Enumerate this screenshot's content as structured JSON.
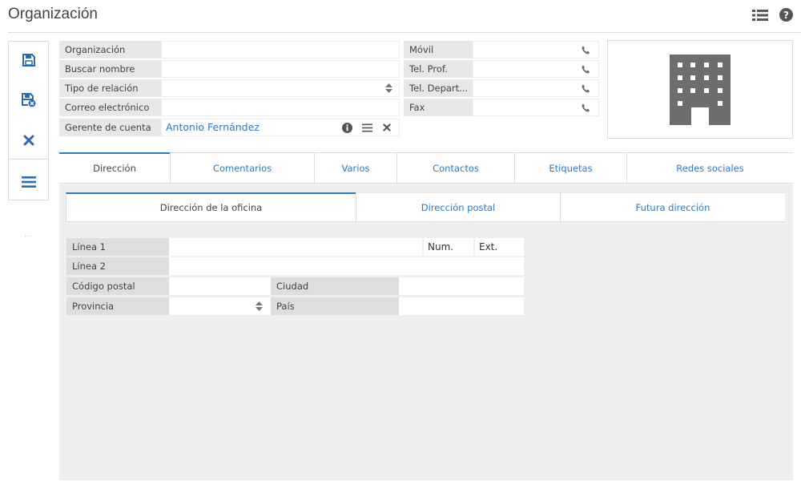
{
  "page": {
    "title": "Organización"
  },
  "icons": {
    "list_view": "list-view-icon",
    "help": "help-icon",
    "save": "save-icon",
    "save_close": "save-close-icon",
    "cancel": "close-icon",
    "menu": "hamburger-menu-icon",
    "phone": "phone-icon",
    "building": "building-icon"
  },
  "toolbar": {
    "more_dots": "..."
  },
  "form": {
    "organization_label": "Organización",
    "organization_value": "",
    "search_name_label": "Buscar nombre",
    "search_name_value": "",
    "relation_type_label": "Tipo de relación",
    "relation_type_value": "",
    "email_label": "Correo electrónico",
    "email_value": "",
    "account_manager_label": "Gerente de cuenta",
    "account_manager_value": "Antonio Fernández",
    "mobile_label": "Móvil",
    "mobile_value": "",
    "work_phone_label": "Tel. Prof.",
    "work_phone_value": "",
    "dept_phone_label": "Tel. Depart...",
    "dept_phone_value": "",
    "fax_label": "Fax",
    "fax_value": ""
  },
  "main_tabs": [
    {
      "label": "Dirección",
      "active": true
    },
    {
      "label": "Comentarios",
      "active": false
    },
    {
      "label": "Varios",
      "active": false
    },
    {
      "label": "Contactos",
      "active": false
    },
    {
      "label": "Etiquetas",
      "active": false
    },
    {
      "label": "Redes sociales",
      "active": false
    }
  ],
  "address_tabs": [
    {
      "label": "Dirección de la oficina",
      "active": true
    },
    {
      "label": "Dirección postal",
      "active": false
    },
    {
      "label": "Futura dirección",
      "active": false
    }
  ],
  "address": {
    "line1_label": "Línea 1",
    "line1_value": "",
    "num_label": "Num.",
    "ext_label": "Ext.",
    "line2_label": "Línea 2",
    "line2_value": "",
    "postal_code_label": "Código postal",
    "postal_code_value": "",
    "city_label": "Ciudad",
    "city_value": "",
    "province_label": "Provincia",
    "province_value": "",
    "country_label": "País",
    "country_value": ""
  },
  "colors": {
    "accent": "#2a7bc6",
    "label_bg": "#e7e7e7",
    "panel_bg": "#efefef",
    "icon_gray": "#6d6d6d",
    "toolbar_blue": "#2a6ab0"
  }
}
